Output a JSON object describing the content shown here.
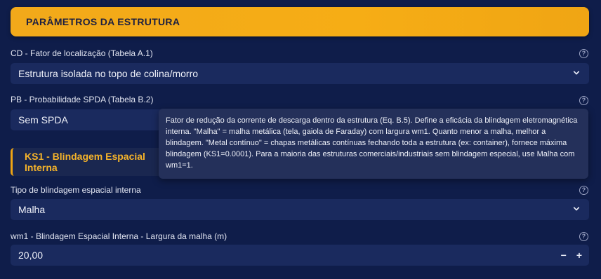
{
  "header": {
    "title": "PARÂMETROS DA ESTRUTURA"
  },
  "cd": {
    "label": "CD - Fator de localização (Tabela A.1)",
    "value": "Estrutura isolada no topo de colina/morro"
  },
  "pb": {
    "label": "PB - Probabilidade SPDA (Tabela B.2)",
    "value": "Sem SPDA"
  },
  "ks1": {
    "title": "KS1 - Blindagem Espacial Interna"
  },
  "tooltip": {
    "text": "Fator de redução da corrente de descarga dentro da estrutura (Eq. B.5). Define a eficácia da blindagem eletromagnética interna. \"Malha\" = malha metálica (tela, gaiola de Faraday) com largura wm1. Quanto menor a malha, melhor a blindagem. \"Metal contínuo\" = chapas metálicas contínuas fechando toda a estrutura (ex: container), fornece máxima blindagem (KS1=0.0001). Para a maioria das estruturas comerciais/industriais sem blindagem especial, use Malha com wm1=1."
  },
  "shield_type": {
    "label": "Tipo de blindagem espacial interna",
    "value": "Malha"
  },
  "wm1": {
    "label": "wm1 - Blindagem Espacial Interna - Largura da malha (m)",
    "value": "20,00",
    "minus": "−",
    "plus": "+"
  },
  "help_glyph": "?",
  "colors": {
    "accent": "#f2a91a",
    "background": "#0f1d4a",
    "field": "#1a2a5e"
  }
}
